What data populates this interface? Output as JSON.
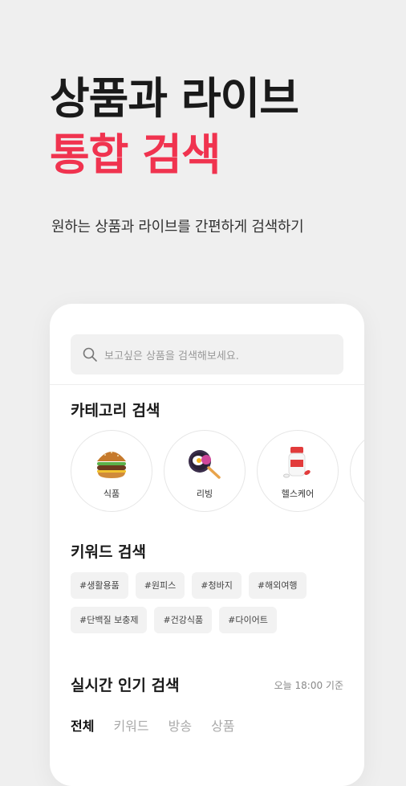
{
  "headline": {
    "line1": "상품과 라이브",
    "line2": "통합 검색"
  },
  "subtitle": "원하는 상품과 라이브를 간편하게 검색하기",
  "search": {
    "placeholder": "보고싶은 상품을 검색해보세요.",
    "icon": "search-icon"
  },
  "category_section": {
    "title": "카테고리 검색",
    "items": [
      {
        "label": "식품",
        "icon": "burger-icon"
      },
      {
        "label": "리빙",
        "icon": "pan-icon"
      },
      {
        "label": "헬스케어",
        "icon": "supplement-icon"
      }
    ]
  },
  "keyword_section": {
    "title": "키워드 검색",
    "tags": [
      "#생활용품",
      "#원피스",
      "#청바지",
      "#해외여행",
      "#단백질 보충제",
      "#건강식품",
      "#다이어트"
    ]
  },
  "popular_section": {
    "title": "실시간 인기 검색",
    "time": "오늘 18:00 기준",
    "tabs": [
      "전체",
      "키워드",
      "방송",
      "상품"
    ]
  },
  "colors": {
    "accent": "#f0334f",
    "background": "#efefef"
  }
}
